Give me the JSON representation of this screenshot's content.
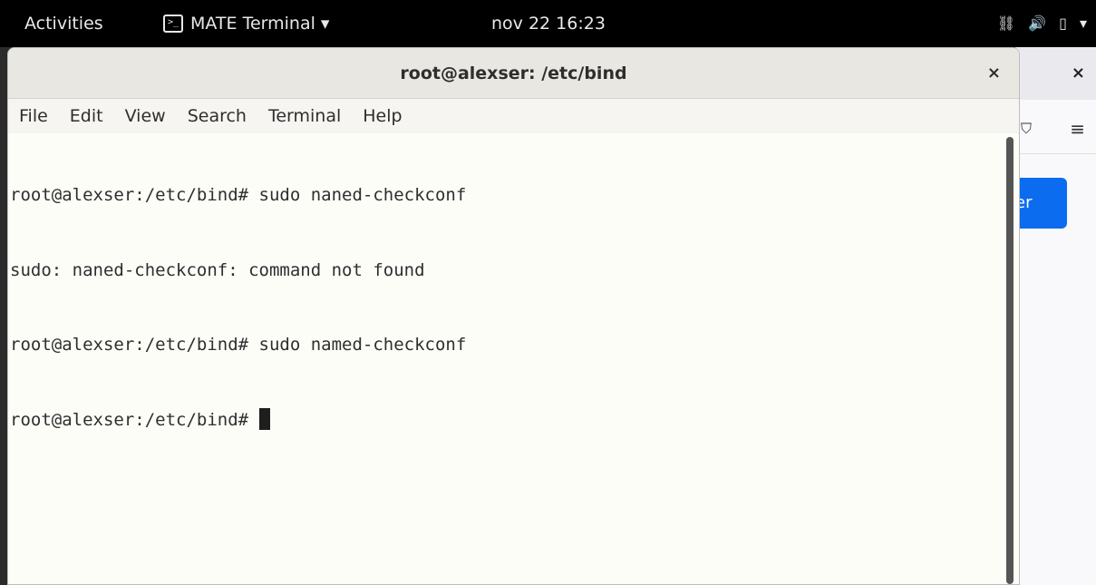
{
  "topbar": {
    "activities": "Activities",
    "app_menu": "MATE Terminal ▾",
    "clock": "nov 22  16:23",
    "network_icon": "network-icon",
    "volume_icon": "volume-icon",
    "battery_icon": "battery-icon",
    "menu_icon": "system-menu-icon"
  },
  "terminal": {
    "title": "root@alexser: /etc/bind",
    "close": "×",
    "menu": [
      "File",
      "Edit",
      "View",
      "Search",
      "Terminal",
      "Help"
    ],
    "lines": [
      "root@alexser:/etc/bind# sudo naned-checkconf",
      "sudo: naned-checkconf: command not found",
      "root@alexser:/etc/bind# sudo named-checkconf",
      "root@alexser:/etc/bind# "
    ]
  },
  "browser": {
    "close": "×",
    "button_text": "er",
    "menu_glyph": "≡"
  }
}
